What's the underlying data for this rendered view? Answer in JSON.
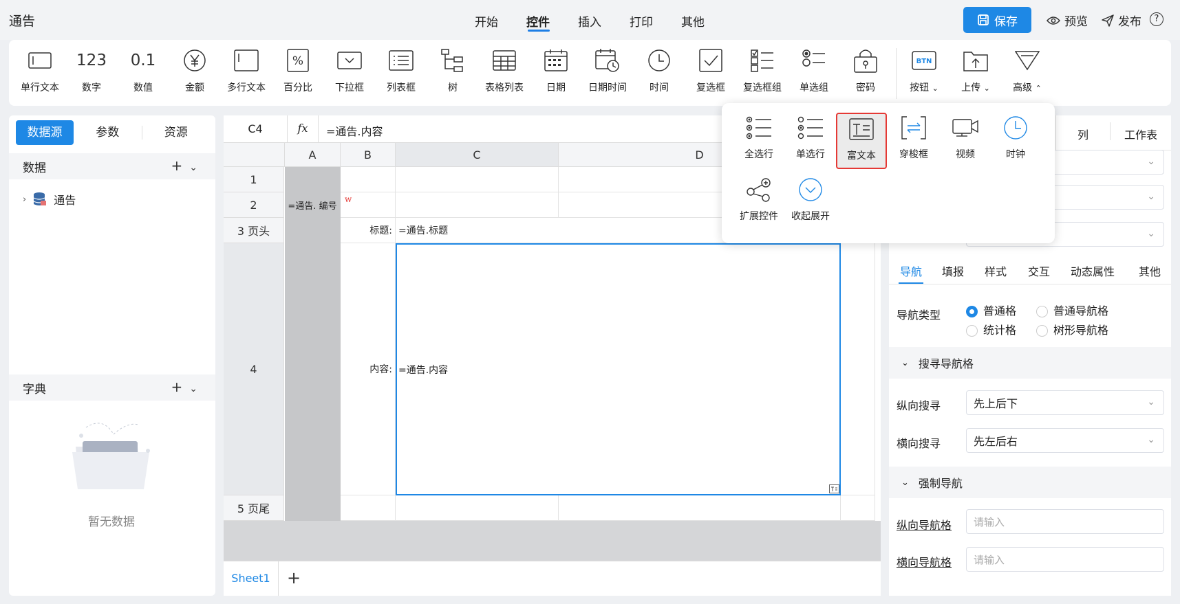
{
  "app": {
    "title": "通告"
  },
  "menu": {
    "tabs": [
      "开始",
      "控件",
      "插入",
      "打印",
      "其他"
    ],
    "active": "控件"
  },
  "header": {
    "save": "保存",
    "preview": "预览",
    "publish": "发布",
    "help": "?"
  },
  "toolbar": {
    "items": [
      "单行文本",
      "数字",
      "数值",
      "金额",
      "多行文本",
      "百分比",
      "下拉框",
      "列表框",
      "树",
      "表格列表",
      "日期",
      "日期时间",
      "时间",
      "复选框",
      "复选框组",
      "单选组",
      "密码",
      "按钮",
      "上传",
      "高级"
    ],
    "number_glyph": "123",
    "decimal_glyph": "0.1"
  },
  "popup": {
    "items": [
      "全选行",
      "单选行",
      "富文本",
      "穿梭框",
      "视频",
      "时钟",
      "扩展控件",
      "收起展开"
    ],
    "selected": "富文本"
  },
  "left": {
    "tabs": [
      "数据源",
      "参数",
      "资源"
    ],
    "data_header": "数据",
    "tree_item": "通告",
    "dict_header": "字典",
    "empty": "暂无数据"
  },
  "formula": {
    "cell": "C4",
    "fx": "fx",
    "text": "=通告.内容"
  },
  "grid": {
    "cols": [
      "A",
      "B",
      "C",
      "D"
    ],
    "rows": [
      "1",
      "2",
      "3 页头",
      "4",
      "5 页尾"
    ],
    "a2": "=通告. 编号",
    "b2_mark": "w",
    "b3": "标题:",
    "c3": "=通告.标题",
    "b4": "内容:",
    "c4": "=通告.内容"
  },
  "sheet": {
    "tab": "Sheet1",
    "add": "+"
  },
  "right": {
    "top_tabs": [
      "列",
      "工作表"
    ],
    "tabs": [
      "导航",
      "填报",
      "样式",
      "交互",
      "动态属性",
      "其他"
    ],
    "nav_type_label": "导航类型",
    "radios": [
      "普通格",
      "普通导航格",
      "统计格",
      "树形导航格"
    ],
    "search_section": "搜寻导航格",
    "v_search_label": "纵向搜寻",
    "v_search_value": "先上后下",
    "h_search_label": "横向搜寻",
    "h_search_value": "先左后右",
    "force_section": "强制导航",
    "v_nav_label": "纵向导航格",
    "h_nav_label": "横向导航格",
    "placeholder": "请输入"
  }
}
